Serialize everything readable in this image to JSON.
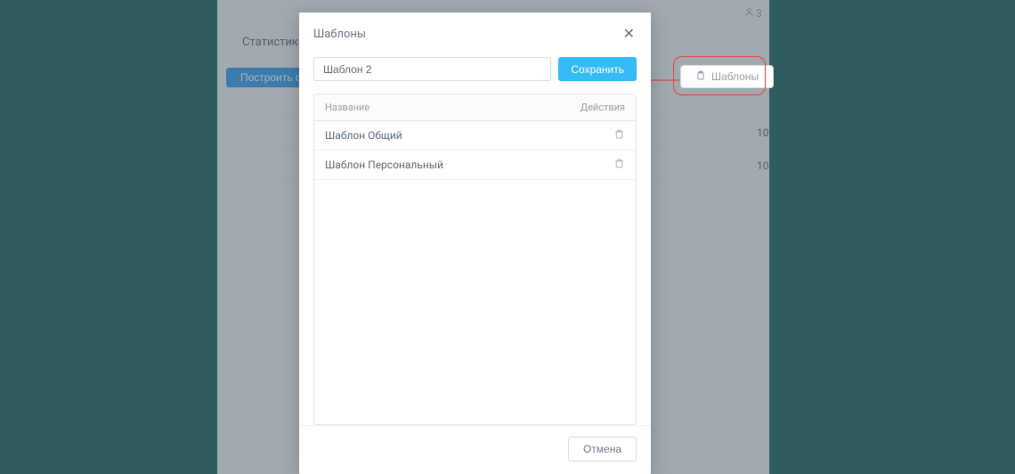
{
  "tabs": {
    "statistics": "Статистика"
  },
  "buttons": {
    "build_report": "Построить отч",
    "templates": "Шаблоны"
  },
  "side": {
    "count_suffix": "3",
    "row1": "10",
    "row2": "10"
  },
  "modal": {
    "title": "Шаблоны",
    "input_value": "Шаблон 2",
    "save_label": "Сохранить",
    "header_name": "Название",
    "header_actions": "Действия",
    "rows": [
      {
        "name": "Шаблон Общий"
      },
      {
        "name": "Шаблон Персональный"
      }
    ],
    "cancel_label": "Отмена"
  }
}
